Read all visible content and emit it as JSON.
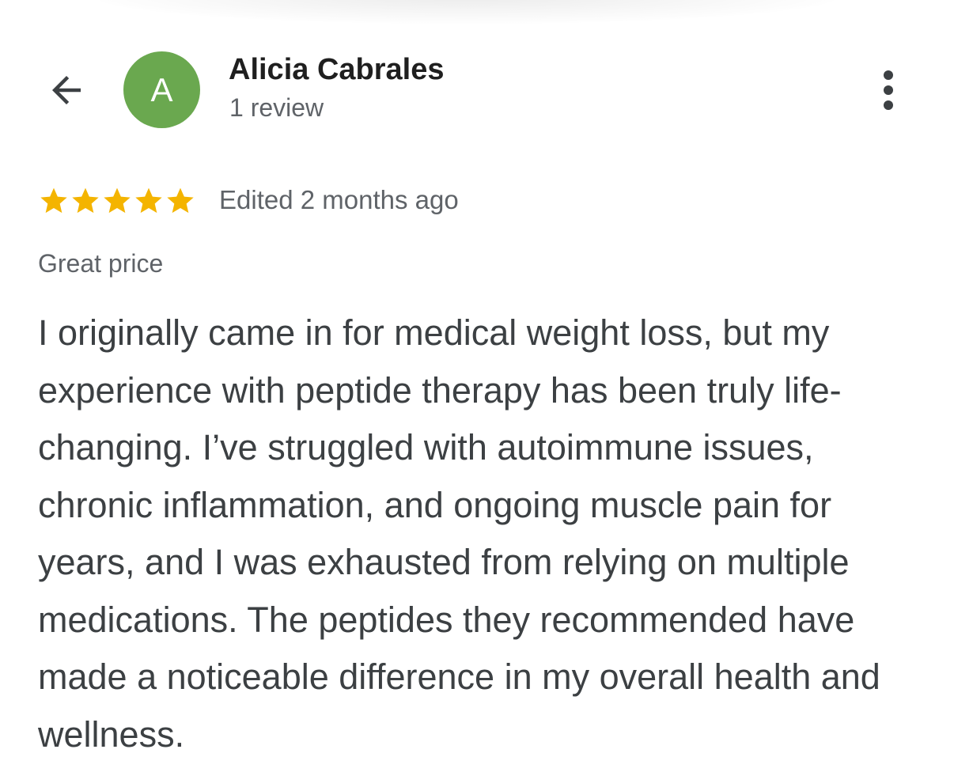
{
  "header": {
    "back_icon": "arrow-back-icon",
    "more_icon": "more-vertical-icon"
  },
  "reviewer": {
    "avatar_letter": "A",
    "avatar_color": "#6aa84f",
    "name": "Alicia Cabrales",
    "review_count": "1 review"
  },
  "review": {
    "rating": 5,
    "max_rating": 5,
    "star_color": "#f4b400",
    "edited": "Edited 2 months ago",
    "tag": "Great price",
    "text": "I originally came in for medical weight loss, but my experience with peptide therapy has been truly life-changing. I’ve struggled with autoimmune issues, chronic inflammation, and ongoing muscle pain for years, and I was exhausted from relying on multiple medications. The peptides they recommended have made a noticeable difference in my overall health and wellness."
  }
}
